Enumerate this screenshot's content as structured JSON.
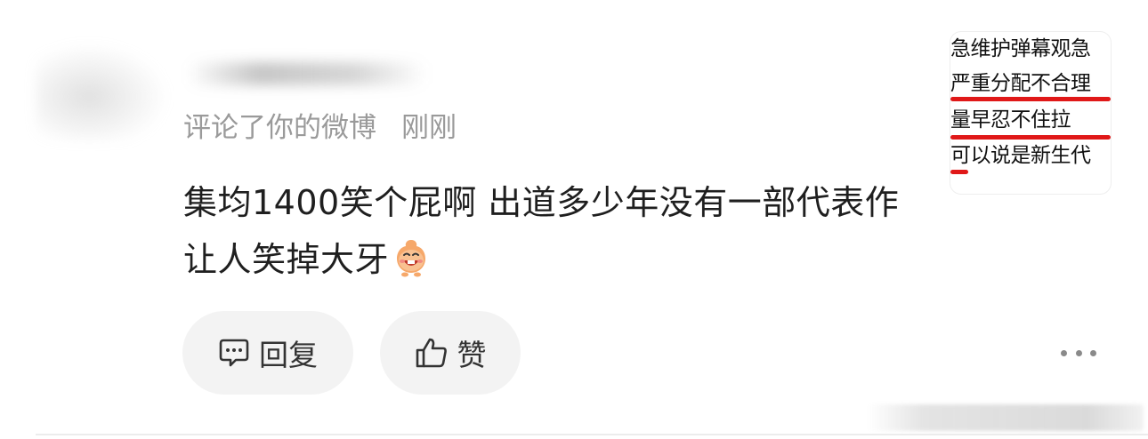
{
  "comment": {
    "action_text": "评论了你的微博",
    "time": "刚刚",
    "text": "集均1400笑个屁啊 出道多少年没有一部代表作 让人笑掉大牙"
  },
  "actions": {
    "reply_label": "回复",
    "like_label": "赞"
  },
  "thumbnail": {
    "lines": [
      "急维护弹幕观急",
      "严重分配不合理",
      "量早忍不住拉",
      "可以说是新生代"
    ],
    "highlight_color": "#e01818"
  },
  "icons": {
    "reply": "comment-icon",
    "like": "thumbs-up-icon",
    "more": "more-icon",
    "emoji": "grinning-emoji-icon"
  }
}
